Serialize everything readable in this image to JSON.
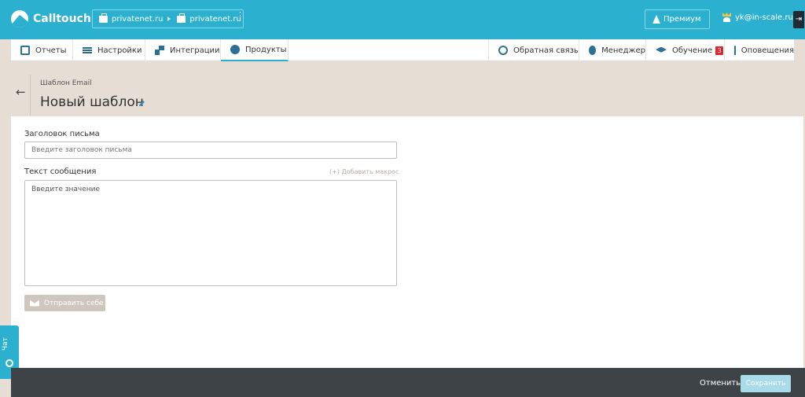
{
  "app": {
    "name": "Calltouch"
  },
  "site_switcher": {
    "account": "privatenet.ru",
    "site": "privatenet.ru",
    "more": "⋮"
  },
  "premium": {
    "label": "Премиум"
  },
  "user": {
    "email": "yk@in-scale.ru"
  },
  "nav": {
    "left": [
      {
        "label": "Отчеты",
        "icon": "reports-icon"
      },
      {
        "label": "Настройки",
        "icon": "settings-icon"
      },
      {
        "label": "Интеграции",
        "icon": "integrations-icon"
      },
      {
        "label": "Продукты",
        "icon": "products-icon",
        "active": true
      }
    ],
    "right": [
      {
        "label": "Обратная связь",
        "icon": "feedback-icon"
      },
      {
        "label": "Менеджер",
        "icon": "manager-icon"
      },
      {
        "label": "Обучение",
        "icon": "study-icon",
        "badge": "3"
      },
      {
        "label": "Оповещения",
        "icon": "bell-icon"
      }
    ]
  },
  "header": {
    "back": "←",
    "breadcrumb": "Шаблон Email",
    "title": "Новый шаблон"
  },
  "form": {
    "subject_label": "Заголовок письма",
    "subject_placeholder": "Введите заголовок письма",
    "subject_value": "",
    "message_label": "Текст сообщения",
    "add_macro": "(+) Добавить макрос",
    "message_placeholder": "Введите значение",
    "message_value": "",
    "send_self": "Отправить себе"
  },
  "chat": {
    "label": "Чат"
  },
  "footer": {
    "cancel": "Отменить",
    "save": "Сохранить"
  },
  "colors": {
    "brand": "#2bb0cf",
    "footer": "#3d4347",
    "page_bg": "#e6ddd5",
    "badge": "#d9282f"
  }
}
